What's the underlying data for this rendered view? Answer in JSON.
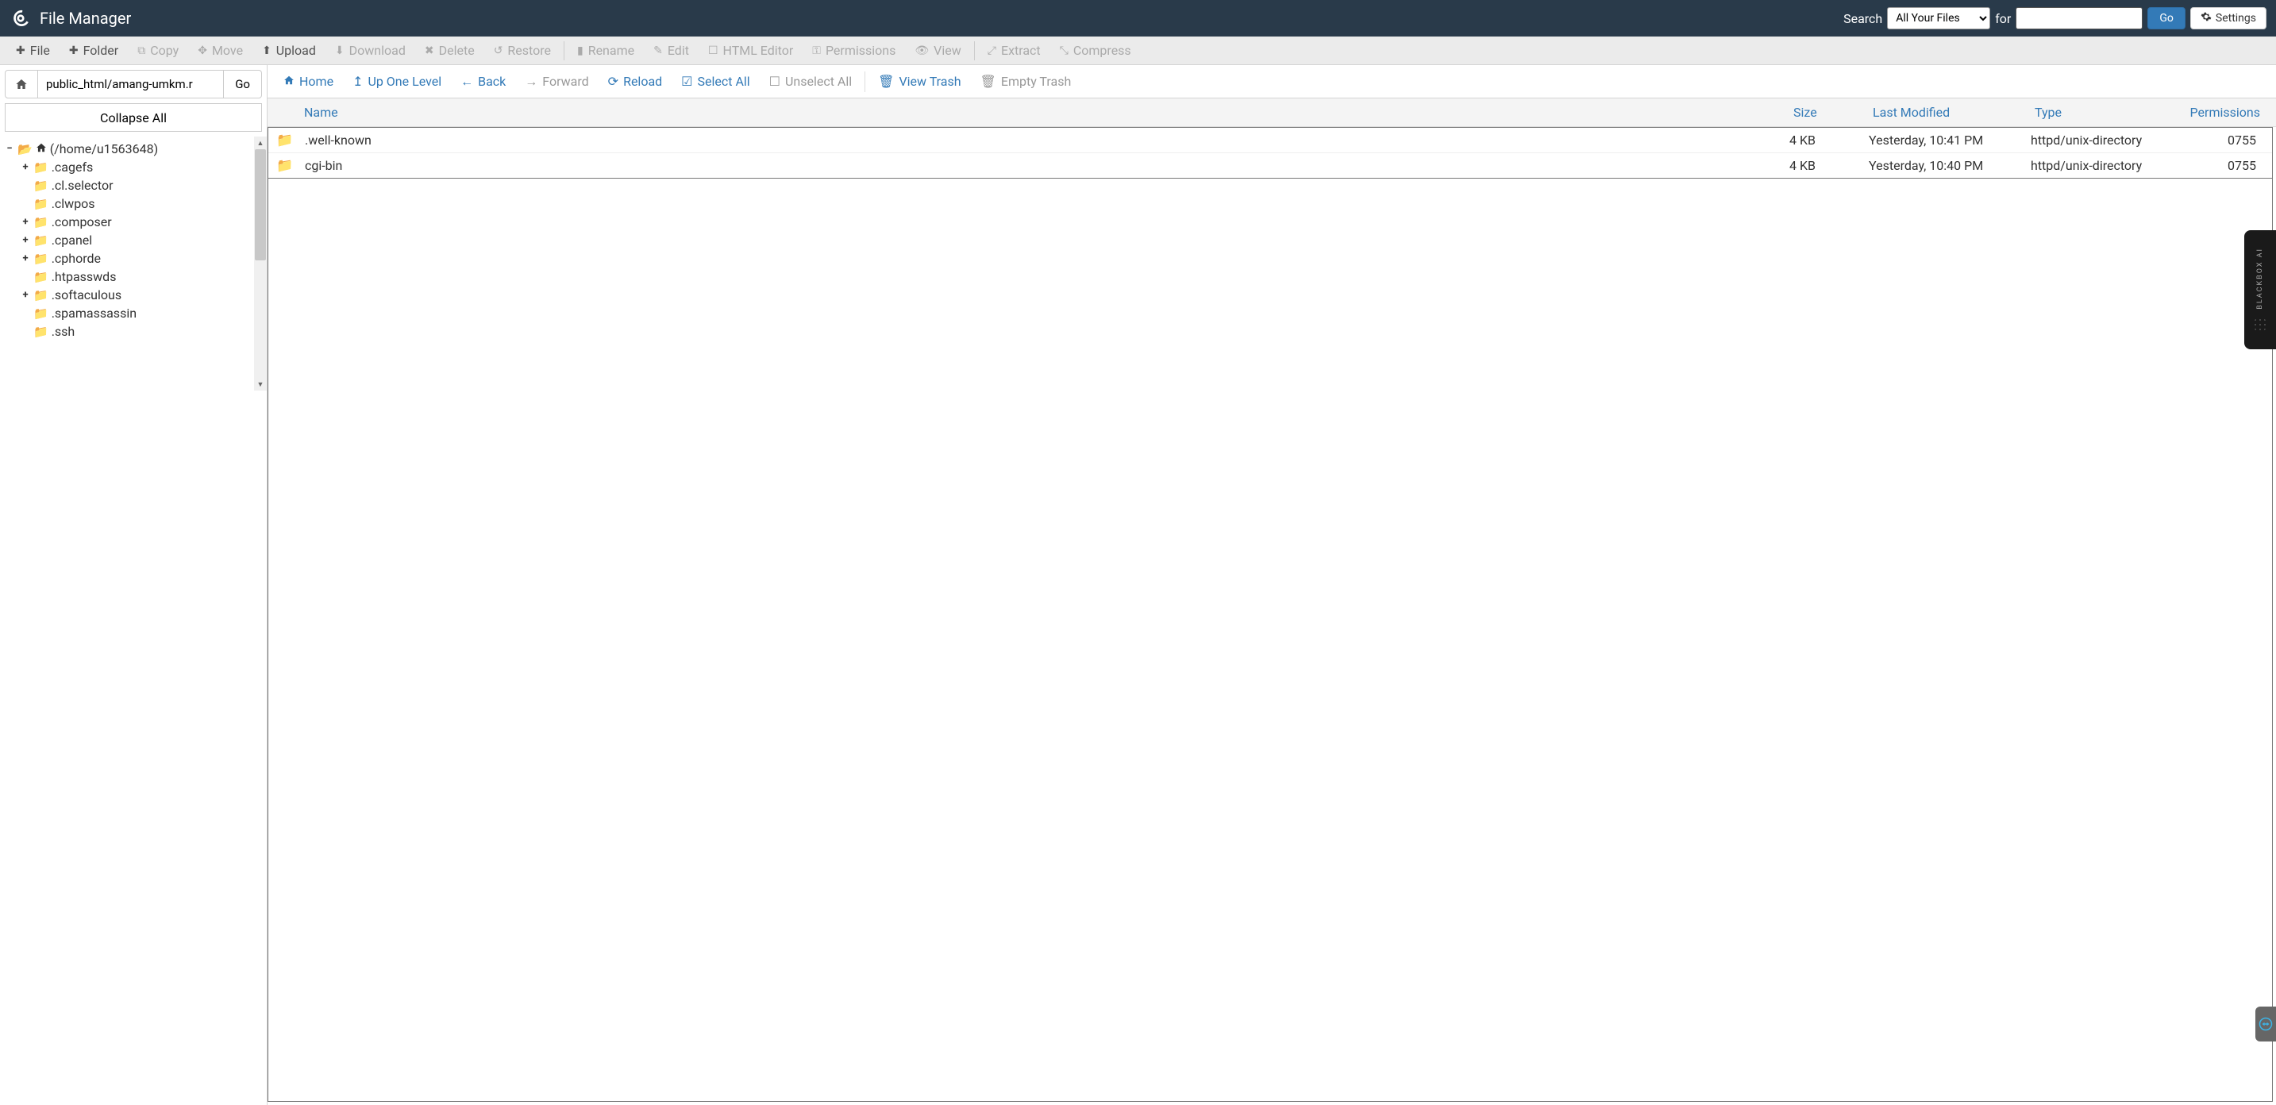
{
  "header": {
    "title": "File Manager",
    "search_label": "Search",
    "search_scope_selected": "All Your Files",
    "for_label": "for",
    "search_value": "",
    "go_label": "Go",
    "settings_label": "Settings"
  },
  "toolbar1": {
    "file": "File",
    "folder": "Folder",
    "copy": "Copy",
    "move": "Move",
    "upload": "Upload",
    "download": "Download",
    "delete": "Delete",
    "restore": "Restore",
    "rename": "Rename",
    "edit": "Edit",
    "html_editor": "HTML Editor",
    "permissions": "Permissions",
    "view": "View",
    "extract": "Extract",
    "compress": "Compress"
  },
  "path_bar": {
    "value": "public_html/amang-umkm.r",
    "go_label": "Go"
  },
  "collapse_label": "Collapse All",
  "tree": {
    "root_label": "(/home/u1563648)",
    "items": [
      {
        "label": ".cagefs",
        "expandable": true
      },
      {
        "label": ".cl.selector",
        "expandable": false
      },
      {
        "label": ".clwpos",
        "expandable": false
      },
      {
        "label": ".composer",
        "expandable": true
      },
      {
        "label": ".cpanel",
        "expandable": true
      },
      {
        "label": ".cphorde",
        "expandable": true
      },
      {
        "label": ".htpasswds",
        "expandable": false
      },
      {
        "label": ".softaculous",
        "expandable": true
      },
      {
        "label": ".spamassassin",
        "expandable": false
      },
      {
        "label": ".ssh",
        "expandable": false
      }
    ]
  },
  "toolbar2": {
    "home": "Home",
    "up_one": "Up One Level",
    "back": "Back",
    "forward": "Forward",
    "reload": "Reload",
    "select_all": "Select All",
    "unselect_all": "Unselect All",
    "view_trash": "View Trash",
    "empty_trash": "Empty Trash"
  },
  "columns": {
    "name": "Name",
    "size": "Size",
    "modified": "Last Modified",
    "type": "Type",
    "permissions": "Permissions"
  },
  "rows": [
    {
      "name": ".well-known",
      "size": "4 KB",
      "modified": "Yesterday, 10:41 PM",
      "type": "httpd/unix-directory",
      "permissions": "0755"
    },
    {
      "name": "cgi-bin",
      "size": "4 KB",
      "modified": "Yesterday, 10:40 PM",
      "type": "httpd/unix-directory",
      "permissions": "0755"
    }
  ],
  "blackbox_label": "BLACKBOX AI"
}
